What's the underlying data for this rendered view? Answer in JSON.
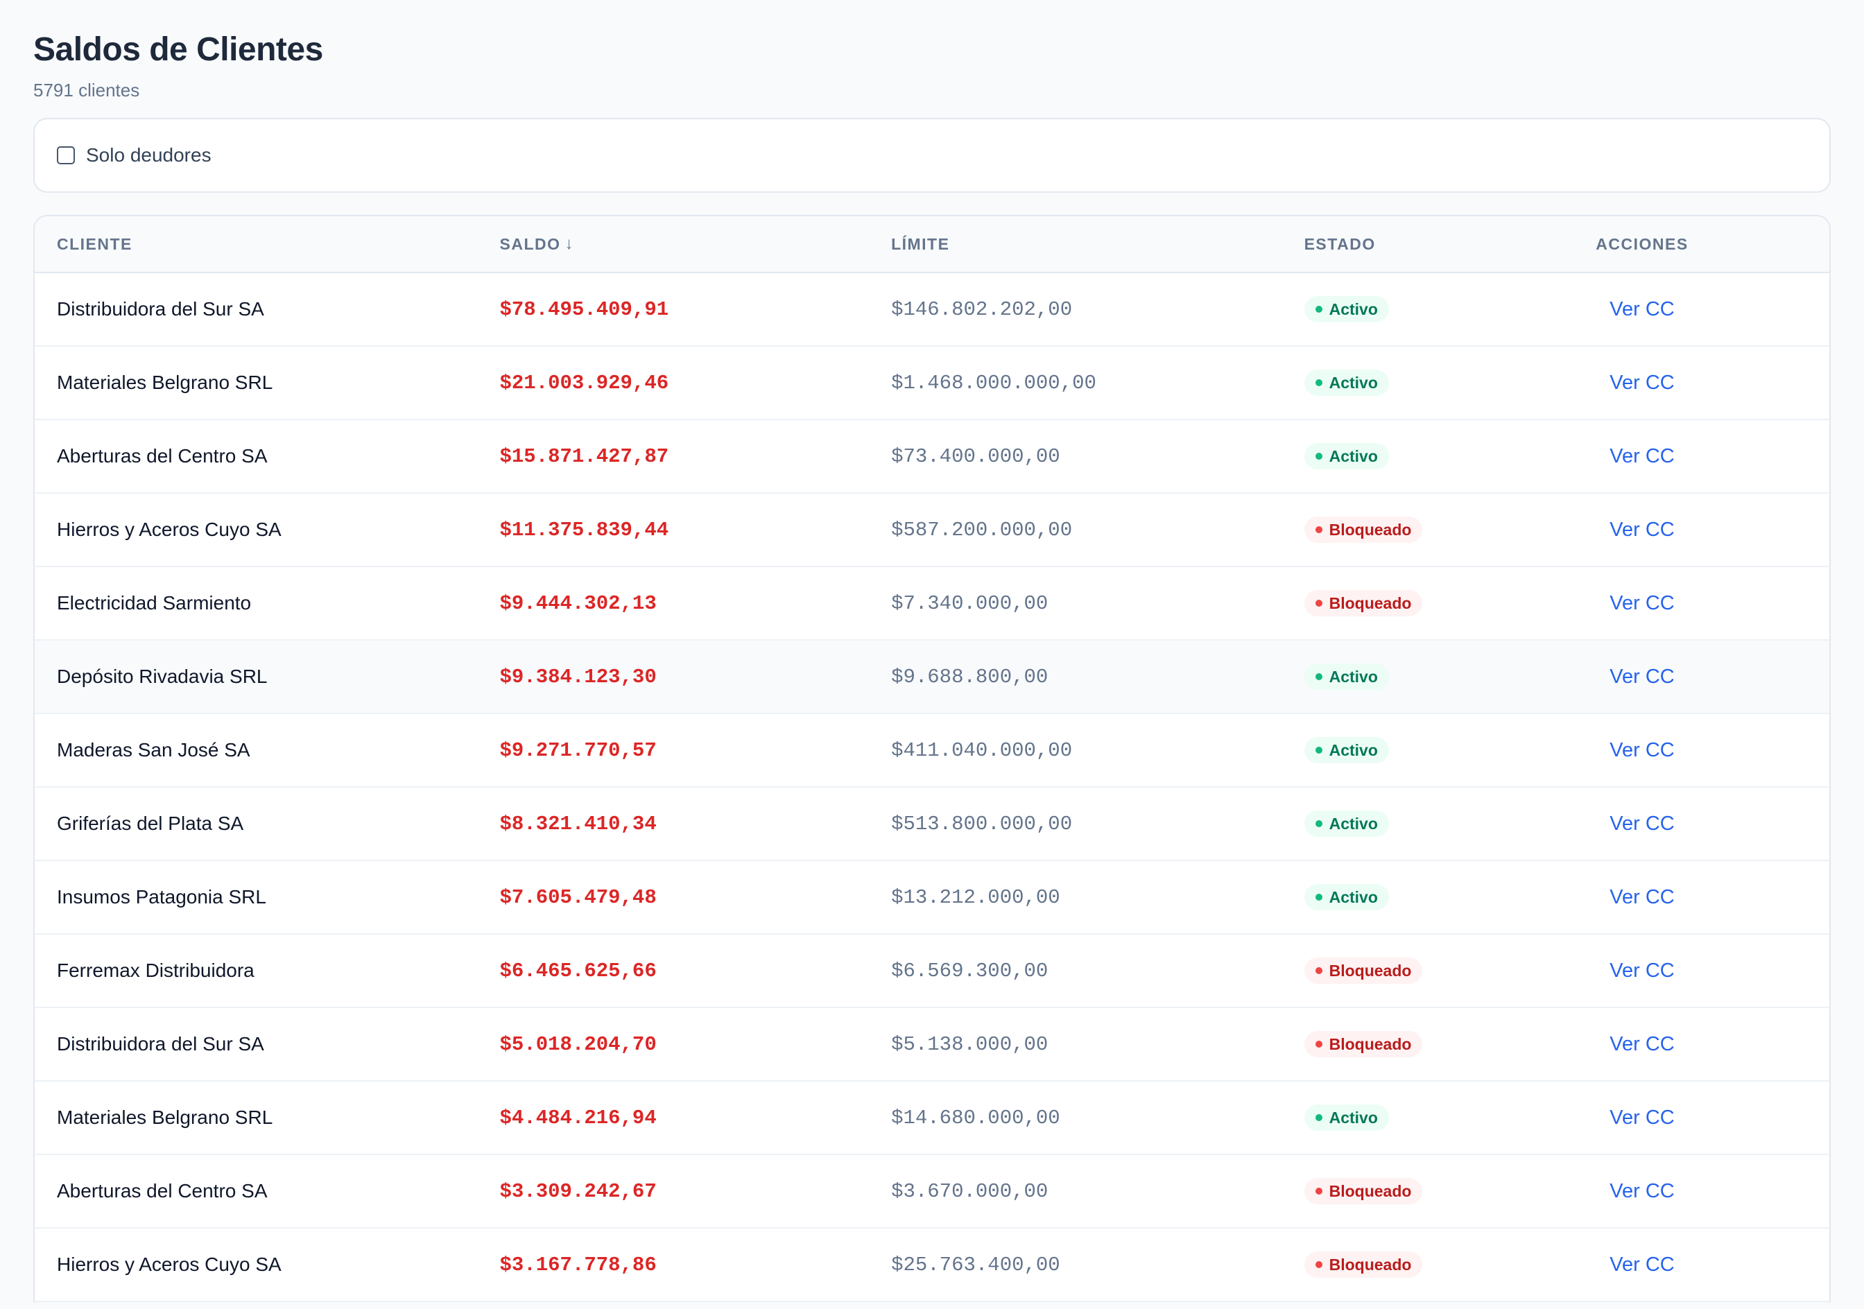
{
  "header": {
    "title": "Saldos de Clientes",
    "subtitle": "5791 clientes"
  },
  "filter": {
    "checkbox_label": "Solo deudores",
    "checked": false
  },
  "table": {
    "columns": {
      "cliente": "CLIENTE",
      "saldo": "SALDO",
      "limite": "LÍMITE",
      "estado": "ESTADO",
      "acciones": "ACCIONES"
    },
    "sort_indicator": "↓",
    "action_label": "Ver CC",
    "rows": [
      {
        "cliente": "Distribuidora del Sur SA",
        "saldo": "$78.495.409,91",
        "limite": "$146.802.202,00",
        "estado": "Activo"
      },
      {
        "cliente": "Materiales Belgrano SRL",
        "saldo": "$21.003.929,46",
        "limite": "$1.468.000.000,00",
        "estado": "Activo"
      },
      {
        "cliente": "Aberturas del Centro SA",
        "saldo": "$15.871.427,87",
        "limite": "$73.400.000,00",
        "estado": "Activo"
      },
      {
        "cliente": "Hierros y Aceros Cuyo SA",
        "saldo": "$11.375.839,44",
        "limite": "$587.200.000,00",
        "estado": "Bloqueado"
      },
      {
        "cliente": "Electricidad Sarmiento",
        "saldo": "$9.444.302,13",
        "limite": "$7.340.000,00",
        "estado": "Bloqueado"
      },
      {
        "cliente": "Depósito Rivadavia SRL",
        "saldo": "$9.384.123,30",
        "limite": "$9.688.800,00",
        "estado": "Activo"
      },
      {
        "cliente": "Maderas San José SA",
        "saldo": "$9.271.770,57",
        "limite": "$411.040.000,00",
        "estado": "Activo"
      },
      {
        "cliente": "Griferías del Plata SA",
        "saldo": "$8.321.410,34",
        "limite": "$513.800.000,00",
        "estado": "Activo"
      },
      {
        "cliente": "Insumos Patagonia SRL",
        "saldo": "$7.605.479,48",
        "limite": "$13.212.000,00",
        "estado": "Activo"
      },
      {
        "cliente": "Ferremax Distribuidora",
        "saldo": "$6.465.625,66",
        "limite": "$6.569.300,00",
        "estado": "Bloqueado"
      },
      {
        "cliente": "Distribuidora del Sur SA",
        "saldo": "$5.018.204,70",
        "limite": "$5.138.000,00",
        "estado": "Bloqueado"
      },
      {
        "cliente": "Materiales Belgrano SRL",
        "saldo": "$4.484.216,94",
        "limite": "$14.680.000,00",
        "estado": "Activo"
      },
      {
        "cliente": "Aberturas del Centro SA",
        "saldo": "$3.309.242,67",
        "limite": "$3.670.000,00",
        "estado": "Bloqueado"
      },
      {
        "cliente": "Hierros y Aceros Cuyo SA",
        "saldo": "$3.167.778,86",
        "limite": "$25.763.400,00",
        "estado": "Bloqueado"
      }
    ]
  },
  "colors": {
    "saldo_negative": "#dc2626",
    "link": "#2563eb",
    "activo_text": "#047857",
    "bloqueado_text": "#b91c1c"
  }
}
